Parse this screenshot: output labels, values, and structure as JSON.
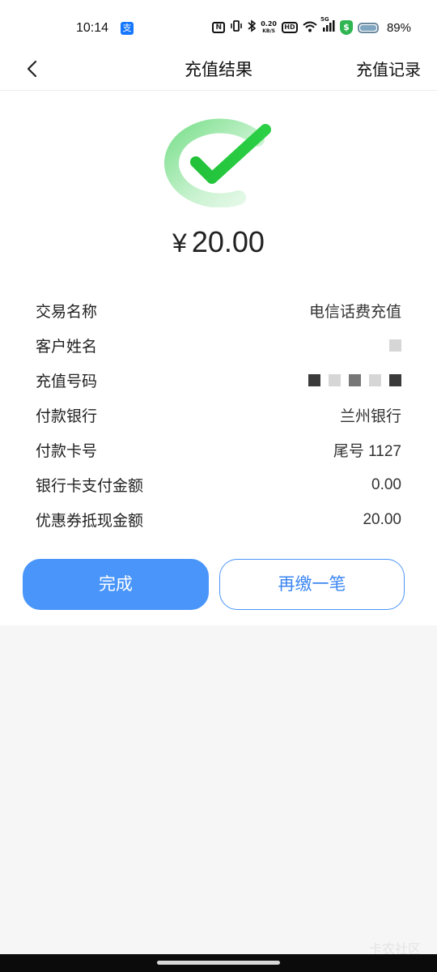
{
  "status_bar": {
    "time": "10:14",
    "alipay_glyph": "支",
    "nfc": "N",
    "speed_value": "0.20",
    "speed_unit": "KB/S",
    "hd": "HD",
    "signal": "5G",
    "shield": "$",
    "battery": "89%"
  },
  "nav": {
    "title": "充值结果",
    "action": "充值记录"
  },
  "result": {
    "currency": "¥",
    "amount": "20.00"
  },
  "details": [
    {
      "label": "交易名称",
      "value": "电信话费充值"
    },
    {
      "label": "客户姓名",
      "value": ""
    },
    {
      "label": "充值号码",
      "value": ""
    },
    {
      "label": "付款银行",
      "value": "兰州银行"
    },
    {
      "label": "付款卡号",
      "value": "尾号 1127"
    },
    {
      "label": "银行卡支付金额",
      "value": "0.00"
    },
    {
      "label": "优惠券抵现金额",
      "value": "20.00"
    }
  ],
  "buttons": {
    "done": "完成",
    "again": "再缴一笔"
  },
  "watermark": "卡农社区",
  "colors": {
    "primary": "#4a95f9",
    "success": "#22c23a",
    "background": "#f6f6f6"
  }
}
